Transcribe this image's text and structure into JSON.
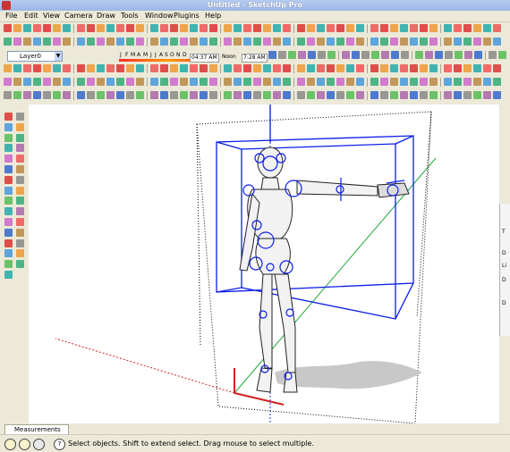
{
  "window": {
    "title": "Untitled - SketchUp Pro"
  },
  "menu": [
    "File",
    "Edit",
    "View",
    "Camera",
    "Draw",
    "Tools",
    "Window",
    "Plugins",
    "Help"
  ],
  "layer": {
    "label": "Layer0"
  },
  "shadows": {
    "months": [
      "J",
      "F",
      "M",
      "A",
      "M",
      "J",
      "J",
      "A",
      "S",
      "O",
      "N",
      "D"
    ],
    "time_start": "04:37",
    "time_label": "AM",
    "noon_label": "Noon",
    "time_end": "7:28",
    "time_end_label": "AM"
  },
  "icons": {
    "toolbar": [
      "new-icon",
      "open-icon",
      "save-icon",
      "cut-icon",
      "copy-icon",
      "paste-icon",
      "erase-icon",
      "undo-icon",
      "redo-icon",
      "print-icon",
      "model-info-icon",
      "select-icon",
      "paint-bucket-icon",
      "eraser-icon",
      "rectangle-icon",
      "line-icon",
      "circle-icon",
      "arc-icon",
      "polygon-icon",
      "freehand-icon",
      "move-icon",
      "push-pull-icon",
      "rotate-icon",
      "follow-me-icon",
      "scale-icon",
      "offset-icon",
      "tape-measure-icon",
      "dimension-icon",
      "protractor-icon",
      "text-icon",
      "axes-icon",
      "3d-text-icon",
      "orbit-icon",
      "pan-icon",
      "zoom-icon",
      "zoom-window-icon",
      "zoom-extents-icon",
      "previous-view-icon",
      "next-view-icon",
      "position-camera-icon",
      "walk-icon",
      "look-around-icon",
      "section-plane-icon",
      "iso-view-icon",
      "top-view-icon",
      "front-view-icon",
      "right-view-icon",
      "back-view-icon",
      "left-view-icon",
      "xray-icon",
      "wireframe-icon",
      "hidden-line-icon",
      "shaded-icon",
      "shaded-texture-icon",
      "monochrome-icon"
    ],
    "left_toolbar": [
      "select-icon",
      "make-component-icon",
      "paint-bucket-icon",
      "eraser-icon",
      "rectangle-icon",
      "line-icon",
      "circle-icon",
      "arc-icon",
      "polygon-icon",
      "freehand-icon",
      "move-icon",
      "push-pull-icon",
      "rotate-icon",
      "follow-me-icon",
      "scale-icon",
      "offset-icon",
      "tape-measure-icon",
      "dimension-icon",
      "protractor-icon",
      "text-icon",
      "axes-icon",
      "3d-text-icon",
      "orbit-icon",
      "pan-icon",
      "zoom-icon",
      "zoom-window-icon",
      "zoom-extents-icon",
      "position-camera-icon",
      "walk-icon",
      "look-around-icon",
      "section-plane-icon"
    ]
  },
  "colors": {
    "selection": "#0b1de8",
    "axis_red": "#d42020",
    "axis_green": "#22a83a",
    "axis_blue": "#1a3ad8"
  },
  "right_panel_letters": [
    "T",
    "D",
    "Li",
    "D",
    "D"
  ],
  "measurements": {
    "label": "Measurements"
  },
  "status": {
    "message": "Select objects. Shift to extend select. Drag mouse to select multiple."
  }
}
